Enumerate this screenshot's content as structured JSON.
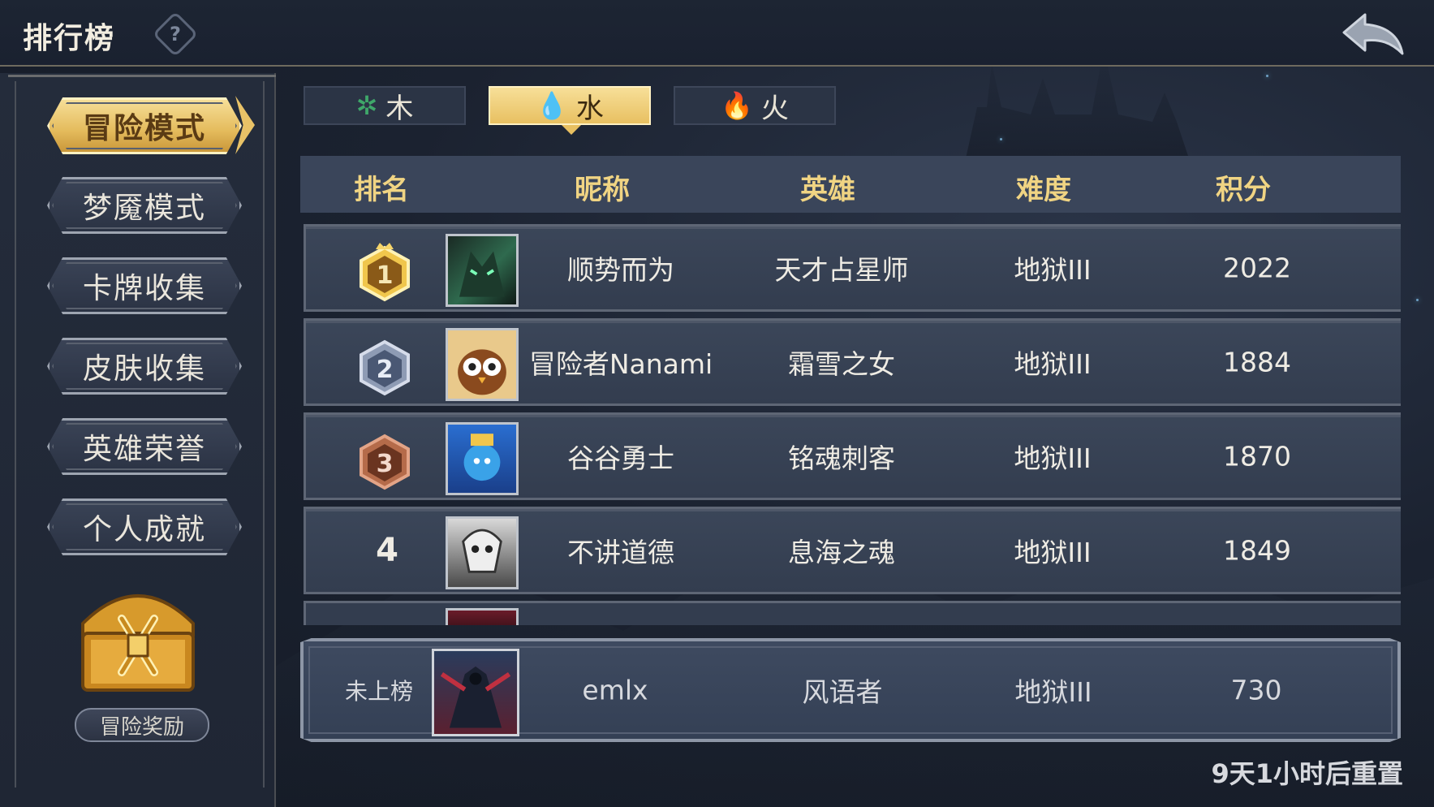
{
  "header": {
    "title": "排行榜",
    "help_icon": "question-icon",
    "back_icon": "back-arrow-icon"
  },
  "sidebar": {
    "modes": [
      {
        "label": "冒险模式",
        "active": true
      },
      {
        "label": "梦魇模式",
        "active": false
      },
      {
        "label": "卡牌收集",
        "active": false
      },
      {
        "label": "皮肤收集",
        "active": false
      },
      {
        "label": "英雄荣誉",
        "active": false
      },
      {
        "label": "个人成就",
        "active": false
      }
    ],
    "reward_label": "冒险奖励"
  },
  "tabs": [
    {
      "icon": "leaf-icon",
      "label": "木",
      "active": false,
      "color": "#3fa86a"
    },
    {
      "icon": "water-drop-icon",
      "label": "水",
      "active": true,
      "color": "#2b90d6"
    },
    {
      "icon": "fire-icon",
      "label": "火",
      "active": false,
      "color": "#d23a2a"
    }
  ],
  "table": {
    "headers": [
      "排名",
      "昵称",
      "英雄",
      "难度",
      "积分"
    ],
    "rows": [
      {
        "rank": "1",
        "nickname": "顺势而为",
        "hero": "天才占星师",
        "difficulty": "地狱III",
        "score": "2022"
      },
      {
        "rank": "2",
        "nickname": "冒险者Nanami",
        "hero": "霜雪之女",
        "difficulty": "地狱III",
        "score": "1884"
      },
      {
        "rank": "3",
        "nickname": "谷谷勇士",
        "hero": "铭魂刺客",
        "difficulty": "地狱III",
        "score": "1870"
      },
      {
        "rank": "4",
        "nickname": "不讲道德",
        "hero": "息海之魂",
        "difficulty": "地狱III",
        "score": "1849"
      }
    ]
  },
  "my_entry": {
    "rank": "未上榜",
    "nickname": "emlx",
    "hero": "风语者",
    "difficulty": "地狱III",
    "score": "730"
  },
  "reset_text": "9天1小时后重置"
}
